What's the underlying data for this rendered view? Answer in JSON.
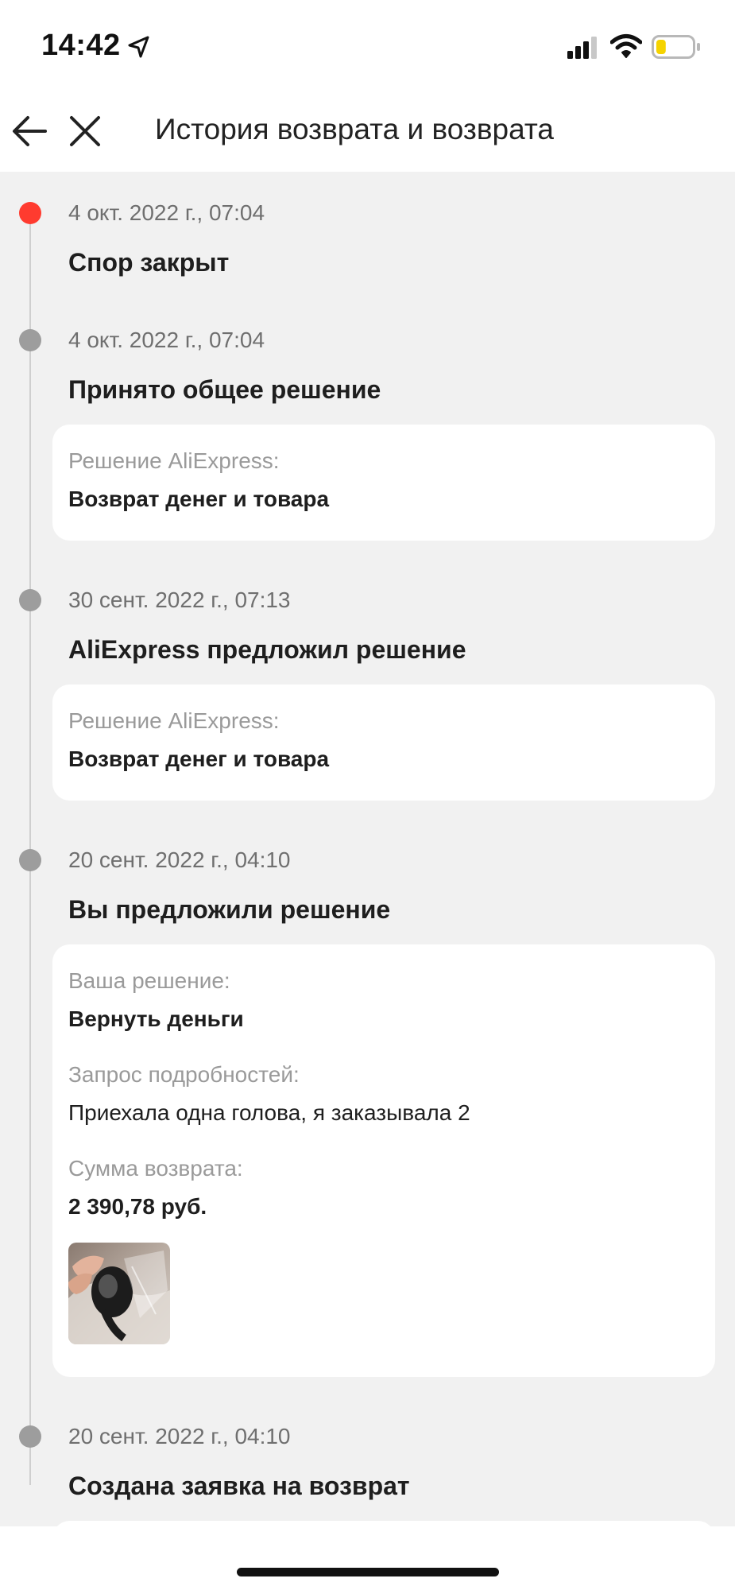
{
  "status_bar": {
    "time": "14:42",
    "icons": [
      "location-arrow-icon",
      "cellular-signal-icon",
      "wifi-icon",
      "battery-low-icon"
    ],
    "battery_level": 0.2,
    "battery_color": "#f5d300"
  },
  "header": {
    "back_icon": "arrow-left-icon",
    "close_icon": "close-icon",
    "title": "История возврата и возврата"
  },
  "colors": {
    "active_dot": "#ff3b2f",
    "inactive_dot": "#9d9d9d",
    "background": "#f1f1f1",
    "card": "#ffffff"
  },
  "events": [
    {
      "date": "4 окт. 2022 г., 07:04",
      "title": "Спор закрыт",
      "active": true
    },
    {
      "date": "4 окт. 2022 г., 07:04",
      "title": "Принято общее решение",
      "card": [
        {
          "label": "Решение AliExpress:",
          "value": "Возврат денег и товара"
        }
      ]
    },
    {
      "date": "30 сент. 2022 г., 07:13",
      "title": "AliExpress предложил решение",
      "card": [
        {
          "label": "Решение AliExpress:",
          "value": "Возврат денег и товара"
        }
      ]
    },
    {
      "date": "20 сент. 2022 г., 04:10",
      "title": "Вы предложили решение",
      "card": [
        {
          "label": "Ваша решение:",
          "value": "Вернуть деньги"
        },
        {
          "label": "Запрос подробностей:",
          "value": "Приехала одна голова, я заказывала 2"
        },
        {
          "label": "Сумма возврата:",
          "value": "2 390,78 руб."
        }
      ],
      "photo": "attached-photo"
    },
    {
      "date": "20 сент. 2022 г., 04:10",
      "title": "Создана заявка на возврат"
    }
  ]
}
